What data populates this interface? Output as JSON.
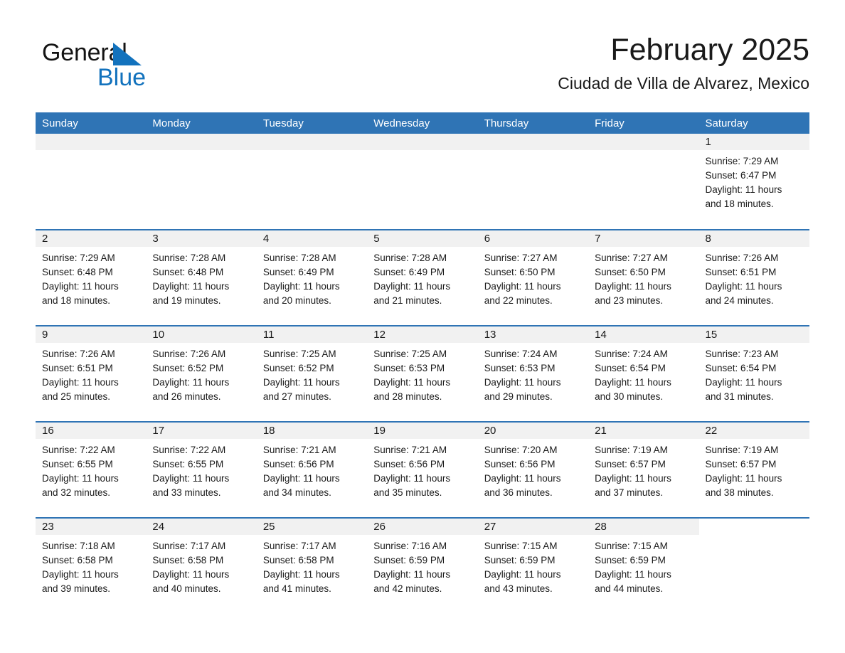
{
  "brand": {
    "name_part1": "General",
    "name_part2": "Blue",
    "triangle_color": "#1272bd"
  },
  "header": {
    "title": "February 2025",
    "subtitle": "Ciudad de Villa de Alvarez, Mexico",
    "accent_color": "#2f74b5",
    "daynum_band_color": "#f1f1f1"
  },
  "calendar": {
    "weekday_headers": [
      "Sunday",
      "Monday",
      "Tuesday",
      "Wednesday",
      "Thursday",
      "Friday",
      "Saturday"
    ],
    "weeks": [
      [
        {
          "day": "",
          "empty": true
        },
        {
          "day": "",
          "empty": true
        },
        {
          "day": "",
          "empty": true
        },
        {
          "day": "",
          "empty": true
        },
        {
          "day": "",
          "empty": true
        },
        {
          "day": "",
          "empty": true
        },
        {
          "day": "1",
          "sunrise": "Sunrise: 7:29 AM",
          "sunset": "Sunset: 6:47 PM",
          "daylight1": "Daylight: 11 hours",
          "daylight2": "and 18 minutes."
        }
      ],
      [
        {
          "day": "2",
          "sunrise": "Sunrise: 7:29 AM",
          "sunset": "Sunset: 6:48 PM",
          "daylight1": "Daylight: 11 hours",
          "daylight2": "and 18 minutes."
        },
        {
          "day": "3",
          "sunrise": "Sunrise: 7:28 AM",
          "sunset": "Sunset: 6:48 PM",
          "daylight1": "Daylight: 11 hours",
          "daylight2": "and 19 minutes."
        },
        {
          "day": "4",
          "sunrise": "Sunrise: 7:28 AM",
          "sunset": "Sunset: 6:49 PM",
          "daylight1": "Daylight: 11 hours",
          "daylight2": "and 20 minutes."
        },
        {
          "day": "5",
          "sunrise": "Sunrise: 7:28 AM",
          "sunset": "Sunset: 6:49 PM",
          "daylight1": "Daylight: 11 hours",
          "daylight2": "and 21 minutes."
        },
        {
          "day": "6",
          "sunrise": "Sunrise: 7:27 AM",
          "sunset": "Sunset: 6:50 PM",
          "daylight1": "Daylight: 11 hours",
          "daylight2": "and 22 minutes."
        },
        {
          "day": "7",
          "sunrise": "Sunrise: 7:27 AM",
          "sunset": "Sunset: 6:50 PM",
          "daylight1": "Daylight: 11 hours",
          "daylight2": "and 23 minutes."
        },
        {
          "day": "8",
          "sunrise": "Sunrise: 7:26 AM",
          "sunset": "Sunset: 6:51 PM",
          "daylight1": "Daylight: 11 hours",
          "daylight2": "and 24 minutes."
        }
      ],
      [
        {
          "day": "9",
          "sunrise": "Sunrise: 7:26 AM",
          "sunset": "Sunset: 6:51 PM",
          "daylight1": "Daylight: 11 hours",
          "daylight2": "and 25 minutes."
        },
        {
          "day": "10",
          "sunrise": "Sunrise: 7:26 AM",
          "sunset": "Sunset: 6:52 PM",
          "daylight1": "Daylight: 11 hours",
          "daylight2": "and 26 minutes."
        },
        {
          "day": "11",
          "sunrise": "Sunrise: 7:25 AM",
          "sunset": "Sunset: 6:52 PM",
          "daylight1": "Daylight: 11 hours",
          "daylight2": "and 27 minutes."
        },
        {
          "day": "12",
          "sunrise": "Sunrise: 7:25 AM",
          "sunset": "Sunset: 6:53 PM",
          "daylight1": "Daylight: 11 hours",
          "daylight2": "and 28 minutes."
        },
        {
          "day": "13",
          "sunrise": "Sunrise: 7:24 AM",
          "sunset": "Sunset: 6:53 PM",
          "daylight1": "Daylight: 11 hours",
          "daylight2": "and 29 minutes."
        },
        {
          "day": "14",
          "sunrise": "Sunrise: 7:24 AM",
          "sunset": "Sunset: 6:54 PM",
          "daylight1": "Daylight: 11 hours",
          "daylight2": "and 30 minutes."
        },
        {
          "day": "15",
          "sunrise": "Sunrise: 7:23 AM",
          "sunset": "Sunset: 6:54 PM",
          "daylight1": "Daylight: 11 hours",
          "daylight2": "and 31 minutes."
        }
      ],
      [
        {
          "day": "16",
          "sunrise": "Sunrise: 7:22 AM",
          "sunset": "Sunset: 6:55 PM",
          "daylight1": "Daylight: 11 hours",
          "daylight2": "and 32 minutes."
        },
        {
          "day": "17",
          "sunrise": "Sunrise: 7:22 AM",
          "sunset": "Sunset: 6:55 PM",
          "daylight1": "Daylight: 11 hours",
          "daylight2": "and 33 minutes."
        },
        {
          "day": "18",
          "sunrise": "Sunrise: 7:21 AM",
          "sunset": "Sunset: 6:56 PM",
          "daylight1": "Daylight: 11 hours",
          "daylight2": "and 34 minutes."
        },
        {
          "day": "19",
          "sunrise": "Sunrise: 7:21 AM",
          "sunset": "Sunset: 6:56 PM",
          "daylight1": "Daylight: 11 hours",
          "daylight2": "and 35 minutes."
        },
        {
          "day": "20",
          "sunrise": "Sunrise: 7:20 AM",
          "sunset": "Sunset: 6:56 PM",
          "daylight1": "Daylight: 11 hours",
          "daylight2": "and 36 minutes."
        },
        {
          "day": "21",
          "sunrise": "Sunrise: 7:19 AM",
          "sunset": "Sunset: 6:57 PM",
          "daylight1": "Daylight: 11 hours",
          "daylight2": "and 37 minutes."
        },
        {
          "day": "22",
          "sunrise": "Sunrise: 7:19 AM",
          "sunset": "Sunset: 6:57 PM",
          "daylight1": "Daylight: 11 hours",
          "daylight2": "and 38 minutes."
        }
      ],
      [
        {
          "day": "23",
          "sunrise": "Sunrise: 7:18 AM",
          "sunset": "Sunset: 6:58 PM",
          "daylight1": "Daylight: 11 hours",
          "daylight2": "and 39 minutes."
        },
        {
          "day": "24",
          "sunrise": "Sunrise: 7:17 AM",
          "sunset": "Sunset: 6:58 PM",
          "daylight1": "Daylight: 11 hours",
          "daylight2": "and 40 minutes."
        },
        {
          "day": "25",
          "sunrise": "Sunrise: 7:17 AM",
          "sunset": "Sunset: 6:58 PM",
          "daylight1": "Daylight: 11 hours",
          "daylight2": "and 41 minutes."
        },
        {
          "day": "26",
          "sunrise": "Sunrise: 7:16 AM",
          "sunset": "Sunset: 6:59 PM",
          "daylight1": "Daylight: 11 hours",
          "daylight2": "and 42 minutes."
        },
        {
          "day": "27",
          "sunrise": "Sunrise: 7:15 AM",
          "sunset": "Sunset: 6:59 PM",
          "daylight1": "Daylight: 11 hours",
          "daylight2": "and 43 minutes."
        },
        {
          "day": "28",
          "sunrise": "Sunrise: 7:15 AM",
          "sunset": "Sunset: 6:59 PM",
          "daylight1": "Daylight: 11 hours",
          "daylight2": "and 44 minutes."
        },
        {
          "day": "",
          "empty": true,
          "noband": true
        }
      ]
    ]
  }
}
